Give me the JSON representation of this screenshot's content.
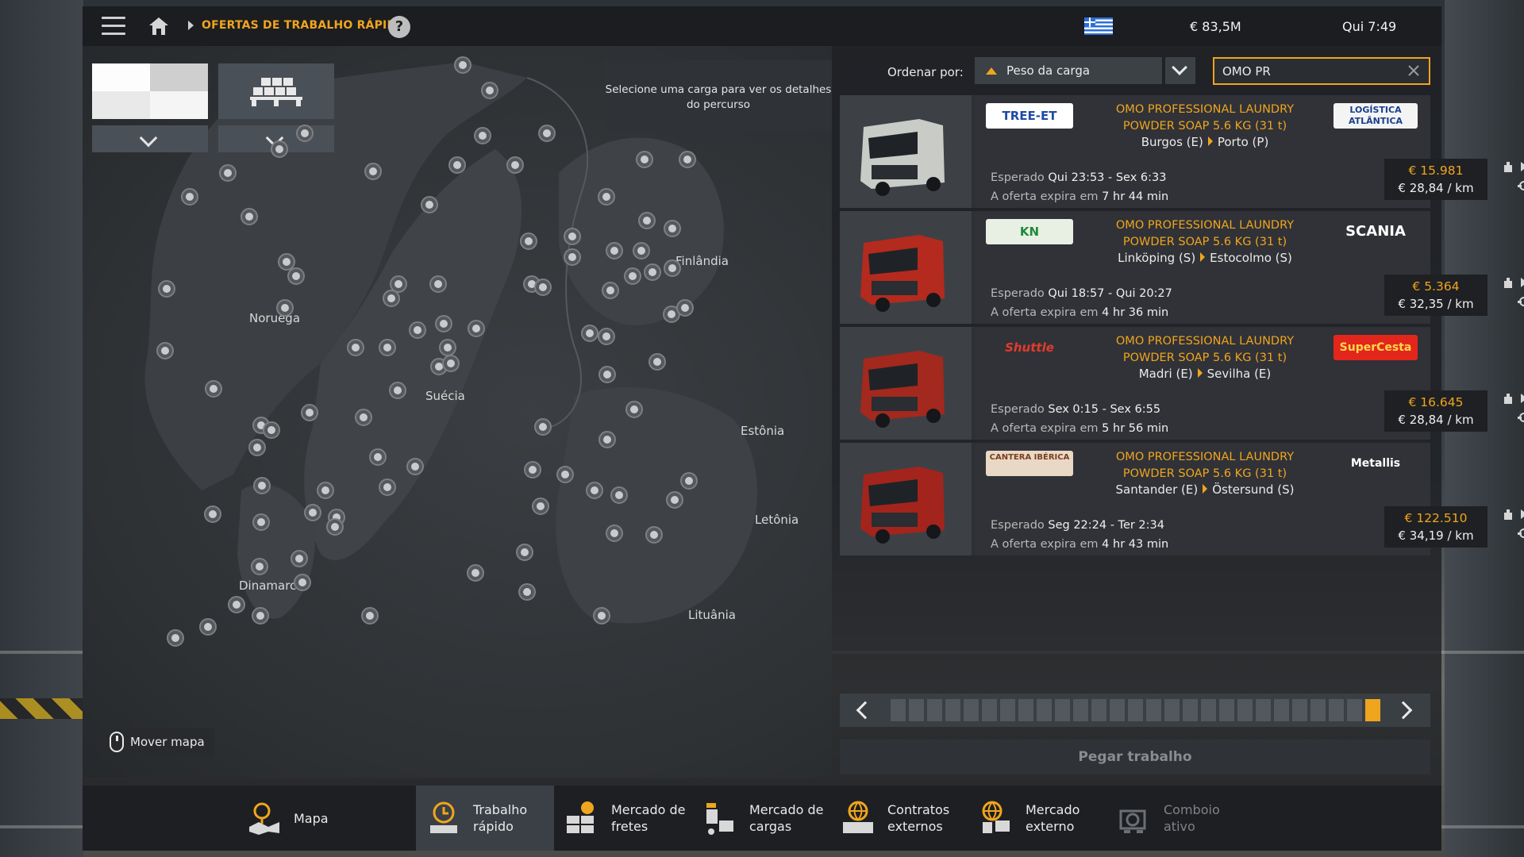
{
  "topbar": {
    "breadcrumb": "OFERTAS DE TRABALHO RÁPIDO",
    "help": "?",
    "money": "€ 83,5M",
    "clock": "Qui 7:49"
  },
  "map": {
    "hint": "Selecione uma carga para ver os detalhes do percurso",
    "move_map": "Mover mapa",
    "countries": [
      "Noruega",
      "Suécia",
      "Finlândia",
      "Estônia",
      "Letônia",
      "Lituânia",
      "Dinamarca"
    ]
  },
  "sort": {
    "label": "Ordenar por:",
    "value": "Peso da carga",
    "search_value": "OMO PR"
  },
  "jobs": [
    {
      "logo_left": "TREE-ET",
      "logo_right": "LOGÍSTICA ATLÂNTICA",
      "cargo_line1": "OMO PROFESSIONAL LAUNDRY",
      "cargo_line2": "POWDER SOAP 5.6 KG (31 t)",
      "from": "Burgos (E)",
      "to": "Porto (P)",
      "expected_label": "Esperado",
      "expected": "Qui 23:53 - Sex 6:33",
      "expires_label": "A oferta expira em",
      "expires": "7 hr 44 min",
      "price": "€ 15.981",
      "per_km": "€ 28,84 / km",
      "truck_color": "#c9cbc6"
    },
    {
      "logo_left": "KN",
      "logo_right": "SCANIA",
      "cargo_line1": "OMO PROFESSIONAL LAUNDRY",
      "cargo_line2": "POWDER SOAP 5.6 KG (31 t)",
      "from": "Linköping (S)",
      "to": "Estocolmo (S)",
      "expected_label": "Esperado",
      "expected": "Qui 18:57 - Qui 20:27",
      "expires_label": "A oferta expira em",
      "expires": "4 hr 36 min",
      "price": "€ 5.364",
      "per_km": "€ 32,35 / km",
      "truck_color": "#b42a1e"
    },
    {
      "logo_left": "Shuttle",
      "logo_right": "SuperCesta",
      "cargo_line1": "OMO PROFESSIONAL LAUNDRY",
      "cargo_line2": "POWDER SOAP 5.6 KG (31 t)",
      "from": "Madri (E)",
      "to": "Sevilha (E)",
      "expected_label": "Esperado",
      "expected": "Sex 0:15 - Sex 6:55",
      "expires_label": "A oferta expira em",
      "expires": "5 hr 56 min",
      "price": "€ 16.645",
      "per_km": "€ 28,84 / km",
      "truck_color": "#a3281d"
    },
    {
      "logo_left": "CANTERA IBÉRICA",
      "logo_right": "Metallis",
      "cargo_line1": "OMO PROFESSIONAL LAUNDRY",
      "cargo_line2": "POWDER SOAP 5.6 KG (31 t)",
      "from": "Santander (E)",
      "to": "Östersund (S)",
      "expected_label": "Esperado",
      "expected": "Seg 22:24 - Ter 2:34",
      "expires_label": "A oferta expira em",
      "expires": "4 hr 43 min",
      "price": "€ 122.510",
      "per_km": "€ 34,19 / km",
      "truck_color": "#a3241c"
    }
  ],
  "pager": {
    "pages": 27,
    "current": 27
  },
  "take_job": "Pegar trabalho",
  "nav": [
    {
      "l1": "Mapa",
      "l2": ""
    },
    {
      "l1": "Trabalho",
      "l2": "rápido"
    },
    {
      "l1": "Mercado de",
      "l2": "fretes"
    },
    {
      "l1": "Mercado de",
      "l2": "cargas"
    },
    {
      "l1": "Contratos",
      "l2": "externos"
    },
    {
      "l1": "Mercado",
      "l2": "externo"
    },
    {
      "l1": "Comboio",
      "l2": "ativo"
    }
  ],
  "colors": {
    "accent": "#f0a51e",
    "panel": "#2d3034"
  }
}
